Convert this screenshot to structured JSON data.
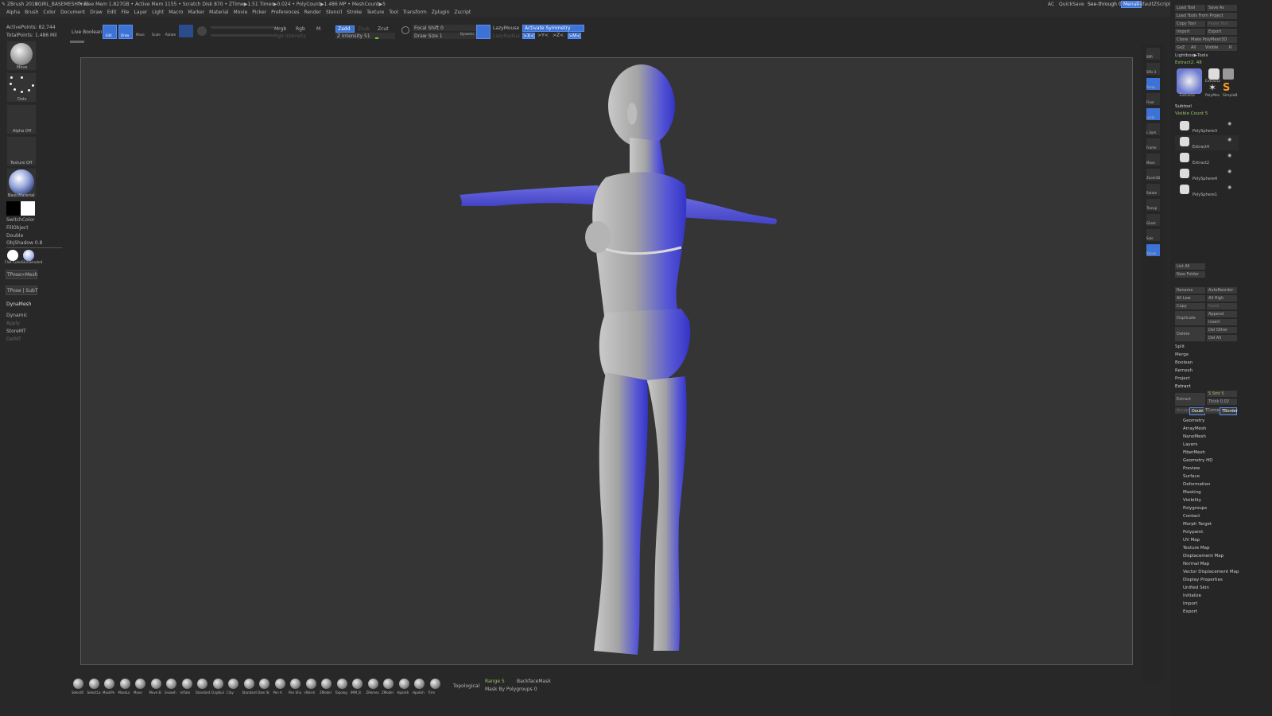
{
  "title_bar": {
    "app": "ZBrush 2019",
    "file": "EGIRL_BASEMESHfinal",
    "stats": "• Free Mem 1.827GB • Active Mem 1155 • Scratch Disk 870 • ZTime▶1.51 Timer▶0.024 • PolyCount▶1.486 MP • MeshCount▶5",
    "ac": "AC",
    "quicksave": "QuickSave",
    "see_through": "See-through  0",
    "menus": "Menus",
    "default_script": "DefaultZScript"
  },
  "menu": [
    "Alpha",
    "Brush",
    "Color",
    "Document",
    "Draw",
    "Edit",
    "File",
    "Layer",
    "Light",
    "Macro",
    "Marker",
    "Material",
    "Movie",
    "Picker",
    "Preferences",
    "Render",
    "Stencil",
    "Stroke",
    "Texture",
    "Tool",
    "Transform",
    "Zplugin",
    "Zscript"
  ],
  "left": {
    "active_points": "ActivePoints: 82,744",
    "total_points": "TotalPoints: 1.486 Mil",
    "brush_label": "Move",
    "stroke_label": "Dots",
    "alpha_label": "Alpha Off",
    "texture_label": "Texture Off",
    "material_label": "BasicMaterial",
    "switch_color": "SwitchColor",
    "fill_object": "FillObject",
    "double": "Double",
    "obj_shadow": "ObjShadow 0.8",
    "flat_color_label": "Flat Color",
    "skinshade_label": "SkinShade4",
    "tpose_mesh": "TPose>Mesh",
    "tpose_subt": "TPose | SubT",
    "dynamesh": "DynaMesh",
    "dynamic": "Dynamic",
    "apply": "Apply",
    "store_mt": "StoreMT",
    "del_mt": "DelMT"
  },
  "top": {
    "live_boolean": "Live Boolean",
    "edit": "Edit",
    "draw": "Draw",
    "move": "Move",
    "scale": "Scale",
    "rotate": "Rotate",
    "mrgb": "Mrgb",
    "rgb": "Rgb",
    "m": "M",
    "zadd": "Zadd",
    "zsub": "Zsub",
    "zcut": "Zcut",
    "rgb_intensity": "Rgb Intensity",
    "z_intensity": "Z Intensity 51",
    "focal_shift": "Focal Shift 0",
    "draw_size": "Draw Size 1",
    "dynamic": "Dynamic",
    "lazy_mouse": "LazyMouse",
    "lazy_radius": "LazyRadius 1",
    "activate_symmetry": "Activate Symmetry",
    "sym_x": ">X<",
    "sym_y": ">Y<",
    "sym_z": ">Z<",
    "sym_m": ">M<"
  },
  "right_shelf": [
    "BPR",
    "SPix 3",
    "Persp",
    "Floor",
    "Local",
    "L.Sym",
    "Frame",
    "Move",
    "Zoom3D",
    "Rotate",
    "Transp",
    "Ghost",
    "Solo",
    "Xpose"
  ],
  "subtool": {
    "load_tool": "Load Tool",
    "save_as": "Save As",
    "load_tools_from_project": "Load Tools From Project",
    "copy_tool": "Copy Tool",
    "paste_tool": "Paste Tool",
    "import": "Import",
    "export": "Export",
    "clone": "Clone",
    "make_polymesh": "Make PolyMesh3D",
    "goz": "GoZ",
    "all": "All",
    "visible": "Visible",
    "r": "R",
    "lightbox_tools": "Lightbox▶Tools",
    "current_tool": "Extract2. 48",
    "thumb_labels": [
      "Extract2",
      "Extract2",
      "PolyMes",
      "SimpleB"
    ],
    "header": "Subtool",
    "visible_count": "Visible Count 5",
    "items": [
      "PolySphere3",
      "Extract4",
      "Extract2",
      "PolySphere4",
      "PolySphere1"
    ],
    "list_all": "List All",
    "new_folder": "New Folder",
    "rename": "Rename",
    "auto_reorder": "AutoReorder",
    "all_low": "All Low",
    "all_high": "All High",
    "copy": "Copy",
    "paste": "Paste",
    "duplicate": "Duplicate",
    "append": "Append",
    "insert": "Insert",
    "delete": "Delete",
    "del_other": "Del Other",
    "del_all": "Del All",
    "split": "Split",
    "merge": "Merge",
    "boolean": "Boolean",
    "remesh": "Remesh",
    "project": "Project",
    "extract": "Extract",
    "extract_btn": "Extract",
    "s_smt": "S Smt 5",
    "thick": "Thick 0.02",
    "accept": "Accept",
    "double": "Double",
    "tcorne": "TCorne",
    "tborder": "TBorder"
  },
  "sections": [
    "Geometry",
    "ArrayMesh",
    "NanoMesh",
    "Layers",
    "FiberMesh",
    "Geometry HD",
    "Preview",
    "Surface",
    "Deformation",
    "Masking",
    "Visibility",
    "Polygroups",
    "Contact",
    "Morph Target",
    "Polypaint",
    "UV Map",
    "Texture Map",
    "Displacement Map",
    "Normal Map",
    "Vector Displacement Map",
    "Display Properties",
    "Unified Skin",
    "Initialize",
    "Import",
    "Export"
  ],
  "bottom": {
    "brushes": [
      "SelectR",
      "SelectLa",
      "MaskPe",
      "MaskLa",
      "Move",
      "Move El",
      "Snakeh",
      "Inflate",
      "Standard",
      "ClayBuil",
      "Clay",
      "Standard",
      "Dam St",
      "Pen A",
      "Pen Sha",
      "sPolish",
      "ZModel",
      "Topolog",
      "IMM_B",
      "ZRemes",
      "ZModel",
      "Hpolish",
      "Hpolish",
      "Trim"
    ],
    "topological": "Topological",
    "range": "Range 5",
    "backface_mask": "BackfaceMask",
    "mask_by_polygroups": "Mask By Polygroups 0"
  },
  "colors": {
    "accent": "#3d73d6",
    "viewport_bg": "#353535",
    "ui_bg": "#282828"
  }
}
